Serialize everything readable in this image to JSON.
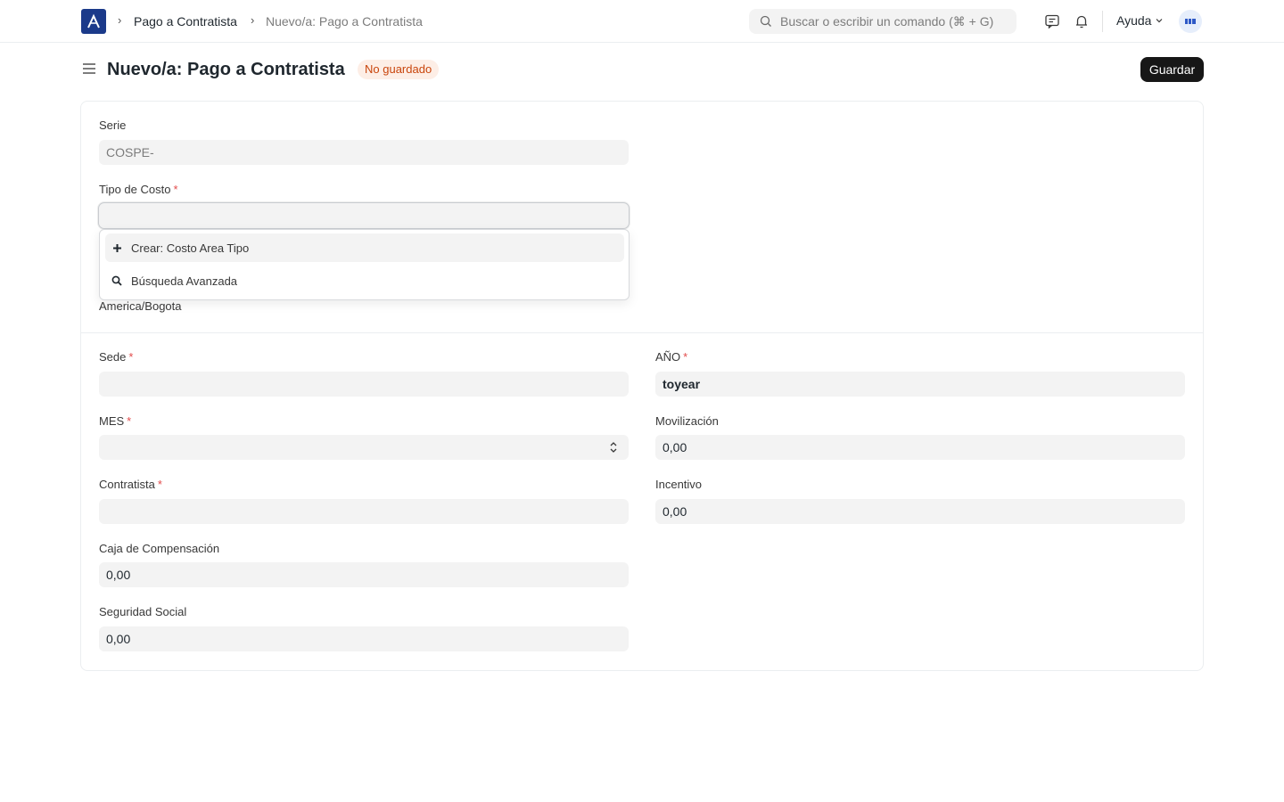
{
  "navbar": {
    "breadcrumbs": [
      "Pago a Contratista",
      "Nuevo/a: Pago a Contratista"
    ],
    "search_placeholder": "Buscar o escribir un comando (⌘ + G)",
    "help_label": "Ayuda"
  },
  "header": {
    "title": "Nuevo/a: Pago a Contratista",
    "status": "No guardado",
    "save_label": "Guardar"
  },
  "form": {
    "serie": {
      "label": "Serie",
      "value": "COSPE-"
    },
    "tipo_costo": {
      "label": "Tipo de Costo",
      "value": ""
    },
    "dropdown": {
      "create": "Crear: Costo Area Tipo",
      "advanced": "Búsqueda Avanzada"
    },
    "timezone": "America/Bogota",
    "sede": {
      "label": "Sede",
      "value": ""
    },
    "mes": {
      "label": "MES",
      "value": ""
    },
    "contratista": {
      "label": "Contratista",
      "value": ""
    },
    "caja": {
      "label": "Caja de Compensación",
      "value": "0,00"
    },
    "seguridad": {
      "label": "Seguridad Social",
      "value": "0,00"
    },
    "anio": {
      "label": "AÑO",
      "value": "toyear"
    },
    "movilizacion": {
      "label": "Movilización",
      "value": "0,00"
    },
    "incentivo": {
      "label": "Incentivo",
      "value": "0,00"
    }
  },
  "colors": {
    "accent": "#171717",
    "badge_bg": "#fdeee6",
    "badge_text": "#c9450c",
    "logo": "#1b3a8a"
  }
}
